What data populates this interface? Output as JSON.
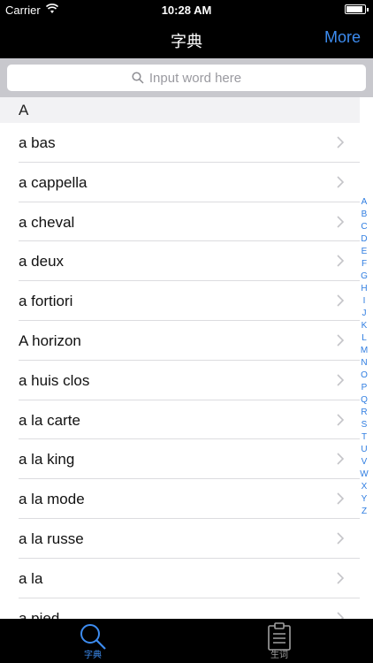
{
  "status": {
    "carrier": "Carrier",
    "time": "10:28 AM",
    "battery_level": 0.9
  },
  "nav": {
    "title": "字典",
    "more_label": "More"
  },
  "search": {
    "placeholder": "Input word here"
  },
  "section": {
    "header": "A"
  },
  "rows": [
    "a bas",
    "a cappella",
    "a cheval",
    "a deux",
    "a fortiori",
    "A horizon",
    "a huis clos",
    "a la carte",
    "a la king",
    "a la mode",
    "a la russe",
    "a la",
    "a pied"
  ],
  "index": [
    "A",
    "B",
    "C",
    "D",
    "E",
    "F",
    "G",
    "H",
    "I",
    "J",
    "K",
    "L",
    "M",
    "N",
    "O",
    "P",
    "Q",
    "R",
    "S",
    "T",
    "U",
    "V",
    "W",
    "X",
    "Y",
    "Z"
  ],
  "tabs": [
    {
      "label": "字典",
      "icon": "search-icon",
      "active": true
    },
    {
      "label": "生词",
      "icon": "clipboard-icon",
      "active": false
    }
  ],
  "colors": {
    "accent": "#3d8cf0",
    "index": "#2f7de1",
    "inactive_tab": "#a0a0a0"
  }
}
